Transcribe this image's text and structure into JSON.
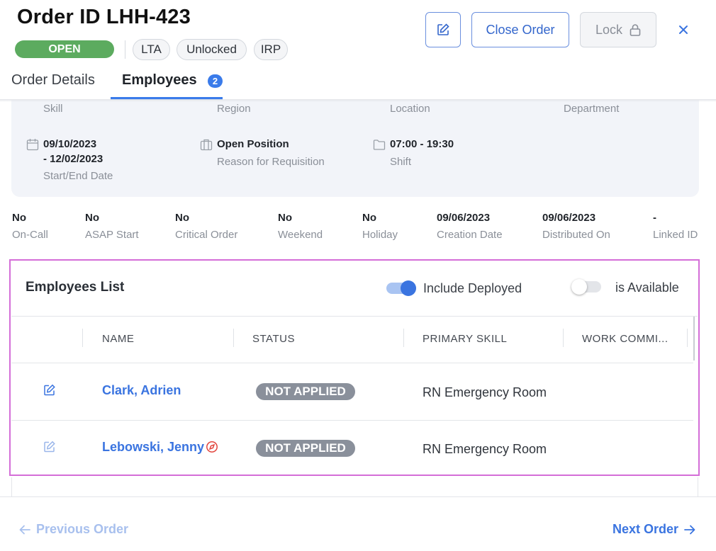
{
  "header": {
    "title": "Order ID LHH-423",
    "status": "OPEN",
    "tags": [
      "LTA",
      "Unlocked",
      "IRP"
    ],
    "close_order_label": "Close Order",
    "lock_label": "Lock"
  },
  "tabs": [
    {
      "label": "Order Details"
    },
    {
      "label": "Employees",
      "badge": "2"
    }
  ],
  "details": {
    "skill_label": "Skill",
    "region_label": "Region",
    "location_label": "Location",
    "department_label": "Department",
    "date_line1": "09/10/2023",
    "date_line2": "- 12/02/2023",
    "date_label": "Start/End Date",
    "reason_value": "Open Position",
    "reason_label": "Reason for Requisition",
    "shift_value": "07:00 - 19:30",
    "shift_label": "Shift"
  },
  "flags": [
    {
      "value": "No",
      "label": "On-Call"
    },
    {
      "value": "No",
      "label": "ASAP Start"
    },
    {
      "value": "No",
      "label": "Critical Order"
    },
    {
      "value": "No",
      "label": "Weekend"
    },
    {
      "value": "No",
      "label": "Holiday"
    },
    {
      "value": "09/06/2023",
      "label": "Creation Date"
    },
    {
      "value": "09/06/2023",
      "label": "Distributed On"
    },
    {
      "value": "-",
      "label": "Linked ID"
    }
  ],
  "employees": {
    "title": "Employees List",
    "include_deployed_label": "Include Deployed",
    "include_deployed_on": true,
    "is_available_label": "is Available",
    "is_available_on": false,
    "columns": [
      "NAME",
      "STATUS",
      "PRIMARY SKILL",
      "WORK COMMI..."
    ],
    "rows": [
      {
        "name": "Clark, Adrien",
        "status": "NOT APPLIED",
        "skill": "RN Emergency Room"
      },
      {
        "name": "Lebowski, Jenny",
        "status": "NOT APPLIED",
        "skill": "RN Emergency Room"
      }
    ]
  },
  "footer": {
    "previous_label": "Previous Order",
    "next_label": "Next Order"
  },
  "colors": {
    "primary": "#3a74e0",
    "open_status": "#5cab5f",
    "not_applied": "#8a909b",
    "highlight_frame": "#d46ed8"
  }
}
